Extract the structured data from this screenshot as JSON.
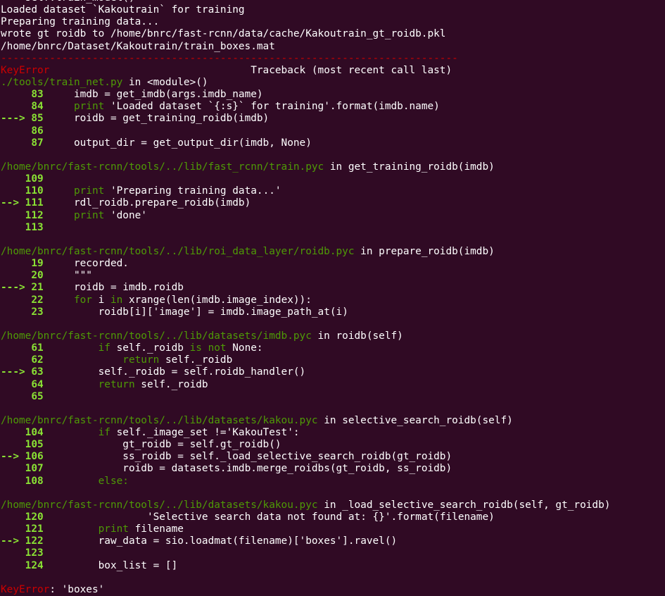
{
  "colors": {
    "background": "#300a24",
    "default": "#ffffff",
    "error": "#cc0000",
    "line_number": "#8ae234",
    "path": "#4e9a06",
    "function": "#06989a",
    "string": "#3465a4"
  },
  "lines": [
    [
      {
        "t": "    ",
        "c": "white"
      },
      {
        "t": "self.train_model()",
        "c": "white"
      }
    ],
    [
      {
        "t": "Loaded dataset `Kakoutrain` for training",
        "c": "white"
      }
    ],
    [
      {
        "t": "Preparing training data...",
        "c": "white"
      }
    ],
    [
      {
        "t": "wrote gt roidb to /home/bnrc/fast-rcnn/data/cache/Kakoutrain_gt_roidb.pkl",
        "c": "white"
      }
    ],
    [
      {
        "t": "/home/bnrc/Dataset/Kakoutrain/train_boxes.mat",
        "c": "white"
      }
    ],
    [
      {
        "t": "---------------------------------------------------------------------------",
        "c": "red"
      }
    ],
    [
      {
        "t": "KeyError",
        "c": "red"
      },
      {
        "t": "                                 Traceback (most recent call last)",
        "c": "white"
      }
    ],
    [
      {
        "t": "./tools/train_net.py",
        "c": "path"
      },
      {
        "t": " in ",
        "c": "white"
      },
      {
        "t": "<module>()",
        "c": "function"
      }
    ],
    [
      {
        "t": "     83",
        "c": "green"
      },
      {
        "t": "     imdb = get_imdb(args.imdb_name)",
        "c": "white"
      }
    ],
    [
      {
        "t": "     84",
        "c": "green"
      },
      {
        "t": "     print ",
        "c": "path"
      },
      {
        "t": "'Loaded dataset `{:s}` for training'",
        "c": "string"
      },
      {
        "t": ".format(imdb.name)",
        "c": "white"
      }
    ],
    [
      {
        "t": "---> 85",
        "c": "green"
      },
      {
        "t": "     roidb = get_training_roidb(imdb)",
        "c": "white"
      }
    ],
    [
      {
        "t": "     86",
        "c": "green"
      }
    ],
    [
      {
        "t": "     87",
        "c": "green"
      },
      {
        "t": "     output_dir = get_output_dir(imdb, None)",
        "c": "white"
      }
    ],
    [
      {
        "t": "",
        "c": "white"
      }
    ],
    [
      {
        "t": "/home/bnrc/fast-rcnn/tools/../lib/fast_rcnn/train.pyc",
        "c": "path"
      },
      {
        "t": " in ",
        "c": "white"
      },
      {
        "t": "get_training_roidb(imdb)",
        "c": "function"
      }
    ],
    [
      {
        "t": "    109",
        "c": "green"
      }
    ],
    [
      {
        "t": "    110",
        "c": "green"
      },
      {
        "t": "     print ",
        "c": "path"
      },
      {
        "t": "'Preparing training data...'",
        "c": "string"
      }
    ],
    [
      {
        "t": "--> 111",
        "c": "green"
      },
      {
        "t": "     rdl_roidb.prepare_roidb(imdb)",
        "c": "white"
      }
    ],
    [
      {
        "t": "    112",
        "c": "green"
      },
      {
        "t": "     print ",
        "c": "path"
      },
      {
        "t": "'done'",
        "c": "string"
      }
    ],
    [
      {
        "t": "    113",
        "c": "green"
      }
    ],
    [
      {
        "t": "",
        "c": "white"
      }
    ],
    [
      {
        "t": "/home/bnrc/fast-rcnn/tools/../lib/roi_data_layer/roidb.pyc",
        "c": "path"
      },
      {
        "t": " in ",
        "c": "white"
      },
      {
        "t": "prepare_roidb(imdb)",
        "c": "function"
      }
    ],
    [
      {
        "t": "     19",
        "c": "green"
      },
      {
        "t": "     recorded.",
        "c": "white"
      }
    ],
    [
      {
        "t": "     20",
        "c": "green"
      },
      {
        "t": "     \"\"\"",
        "c": "white"
      }
    ],
    [
      {
        "t": "---> 21",
        "c": "green"
      },
      {
        "t": "     roidb = imdb.roidb",
        "c": "white"
      }
    ],
    [
      {
        "t": "     22",
        "c": "green"
      },
      {
        "t": "     for ",
        "c": "path"
      },
      {
        "t": "i ",
        "c": "white"
      },
      {
        "t": "in ",
        "c": "path"
      },
      {
        "t": "xrange(len(imdb.image_index)):",
        "c": "white"
      }
    ],
    [
      {
        "t": "     23",
        "c": "green"
      },
      {
        "t": "         roidb[i][",
        "c": "white"
      },
      {
        "t": "'image'",
        "c": "string"
      },
      {
        "t": "] = imdb.image_path_at(i)",
        "c": "white"
      }
    ],
    [
      {
        "t": "",
        "c": "white"
      }
    ],
    [
      {
        "t": "/home/bnrc/fast-rcnn/tools/../lib/datasets/imdb.pyc",
        "c": "path"
      },
      {
        "t": " in ",
        "c": "white"
      },
      {
        "t": "roidb(self)",
        "c": "function"
      }
    ],
    [
      {
        "t": "     61",
        "c": "green"
      },
      {
        "t": "         if ",
        "c": "path"
      },
      {
        "t": "self._roidb ",
        "c": "white"
      },
      {
        "t": "is not ",
        "c": "path"
      },
      {
        "t": "None:",
        "c": "white"
      }
    ],
    [
      {
        "t": "     62",
        "c": "green"
      },
      {
        "t": "             return ",
        "c": "path"
      },
      {
        "t": "self._roidb",
        "c": "white"
      }
    ],
    [
      {
        "t": "---> 63",
        "c": "green"
      },
      {
        "t": "         self._roidb = self.roidb_handler()",
        "c": "white"
      }
    ],
    [
      {
        "t": "     64",
        "c": "green"
      },
      {
        "t": "         return ",
        "c": "path"
      },
      {
        "t": "self._roidb",
        "c": "white"
      }
    ],
    [
      {
        "t": "     65",
        "c": "green"
      }
    ],
    [
      {
        "t": "",
        "c": "white"
      }
    ],
    [
      {
        "t": "/home/bnrc/fast-rcnn/tools/../lib/datasets/kakou.pyc",
        "c": "path"
      },
      {
        "t": " in ",
        "c": "white"
      },
      {
        "t": "selective_search_roidb(self)",
        "c": "function"
      }
    ],
    [
      {
        "t": "    104",
        "c": "green"
      },
      {
        "t": "         if ",
        "c": "path"
      },
      {
        "t": "self._image_set !=",
        "c": "white"
      },
      {
        "t": "'KakouTest'",
        "c": "string"
      },
      {
        "t": ":",
        "c": "white"
      }
    ],
    [
      {
        "t": "    105",
        "c": "green"
      },
      {
        "t": "             gt_roidb = self.gt_roidb()",
        "c": "white"
      }
    ],
    [
      {
        "t": "--> 106",
        "c": "green"
      },
      {
        "t": "             ss_roidb = self._load_selective_search_roidb(gt_roidb)",
        "c": "white"
      }
    ],
    [
      {
        "t": "    107",
        "c": "green"
      },
      {
        "t": "             roidb = datasets.imdb.merge_roidbs(gt_roidb, ss_roidb)",
        "c": "white"
      }
    ],
    [
      {
        "t": "    108",
        "c": "green"
      },
      {
        "t": "         else:",
        "c": "path"
      }
    ],
    [
      {
        "t": "",
        "c": "white"
      }
    ],
    [
      {
        "t": "/home/bnrc/fast-rcnn/tools/../lib/datasets/kakou.pyc",
        "c": "path"
      },
      {
        "t": " in ",
        "c": "white"
      },
      {
        "t": "_load_selective_search_roidb(self, gt_roidb)",
        "c": "function"
      }
    ],
    [
      {
        "t": "    120",
        "c": "green"
      },
      {
        "t": "                 ",
        "c": "white"
      },
      {
        "t": "'Selective search data not found at: {}'",
        "c": "string"
      },
      {
        "t": ".format(filename)",
        "c": "white"
      }
    ],
    [
      {
        "t": "    121",
        "c": "green"
      },
      {
        "t": "         print ",
        "c": "path"
      },
      {
        "t": "filename",
        "c": "white"
      }
    ],
    [
      {
        "t": "--> 122",
        "c": "green"
      },
      {
        "t": "         raw_data = sio.loadmat(filename)[",
        "c": "white"
      },
      {
        "t": "'boxes'",
        "c": "string"
      },
      {
        "t": "].ravel()",
        "c": "white"
      }
    ],
    [
      {
        "t": "    123",
        "c": "green"
      }
    ],
    [
      {
        "t": "    124",
        "c": "green"
      },
      {
        "t": "         box_list = []",
        "c": "white"
      }
    ],
    [
      {
        "t": "",
        "c": "white"
      }
    ],
    [
      {
        "t": "KeyError",
        "c": "red"
      },
      {
        "t": ": 'boxes'",
        "c": "white"
      }
    ]
  ]
}
